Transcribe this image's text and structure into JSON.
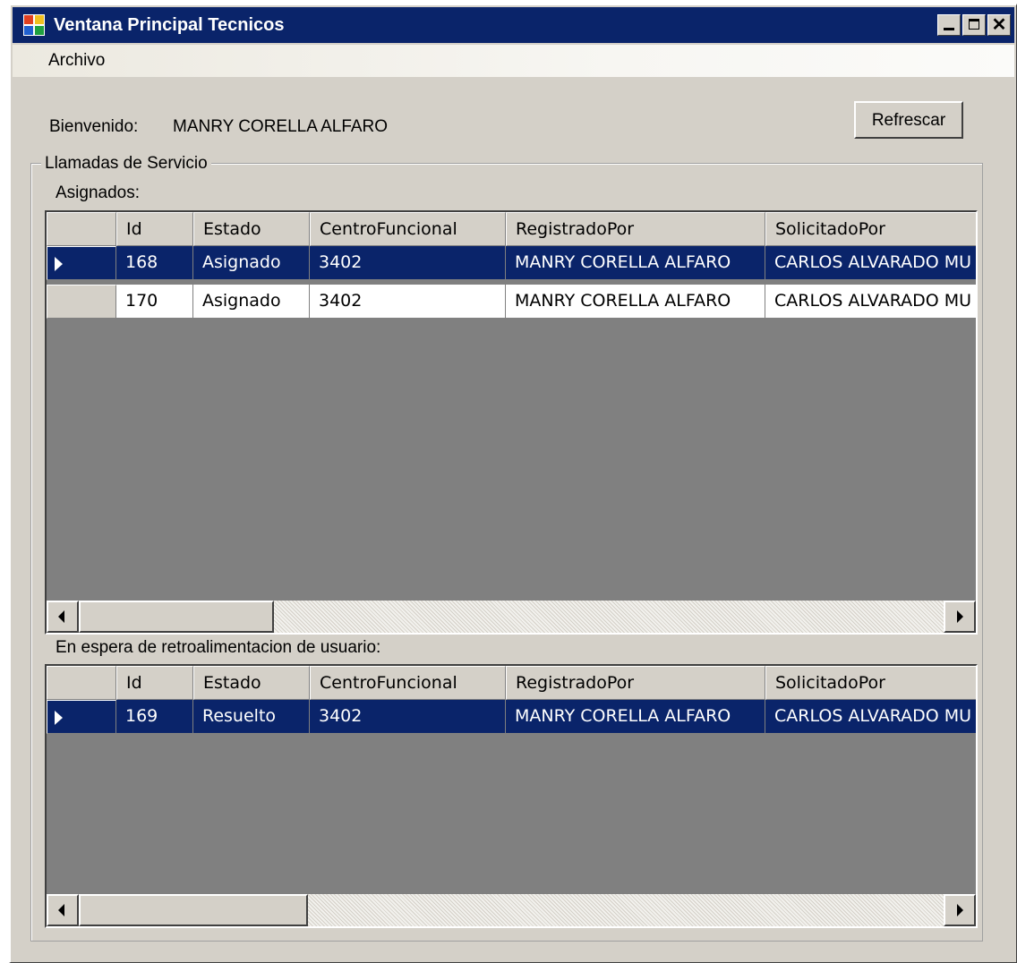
{
  "window": {
    "title": "Ventana Principal Tecnicos",
    "close_glyph": "✕"
  },
  "menu": {
    "items": [
      "Archivo"
    ]
  },
  "welcome": {
    "label": "Bienvenido:",
    "user_name": "MANRY CORELLA ALFARO"
  },
  "refresh_button": "Refrescar",
  "group": {
    "title": "Llamadas de Servicio",
    "assigned_label": "Asignados:",
    "waiting_label": "En espera de retroalimentacion de usuario:"
  },
  "columns": [
    "Id",
    "Estado",
    "CentroFuncional",
    "RegistradoPor",
    "SolicitadoPor"
  ],
  "assigned_rows": [
    {
      "id": "168",
      "estado": "Asignado",
      "centro": "3402",
      "registrado": "MANRY CORELLA ALFARO",
      "solicitado": "CARLOS ALVARADO MU",
      "selected": true
    },
    {
      "id": "170",
      "estado": "Asignado",
      "centro": "3402",
      "registrado": "MANRY CORELLA ALFARO",
      "solicitado": "CARLOS ALVARADO MU",
      "selected": false
    }
  ],
  "waiting_rows": [
    {
      "id": "169",
      "estado": "Resuelto",
      "centro": "3402",
      "registrado": "MANRY CORELLA ALFARO",
      "solicitado": "CARLOS ALVARADO MU",
      "selected": true
    }
  ],
  "colors": {
    "selection": "#0a246a",
    "face": "#d4d0c8",
    "grid_background": "#808080"
  },
  "icons": [
    "app-icon",
    "minimize-icon",
    "maximize-icon",
    "close-icon",
    "row-selector-icon",
    "scroll-left-icon",
    "scroll-right-icon"
  ]
}
